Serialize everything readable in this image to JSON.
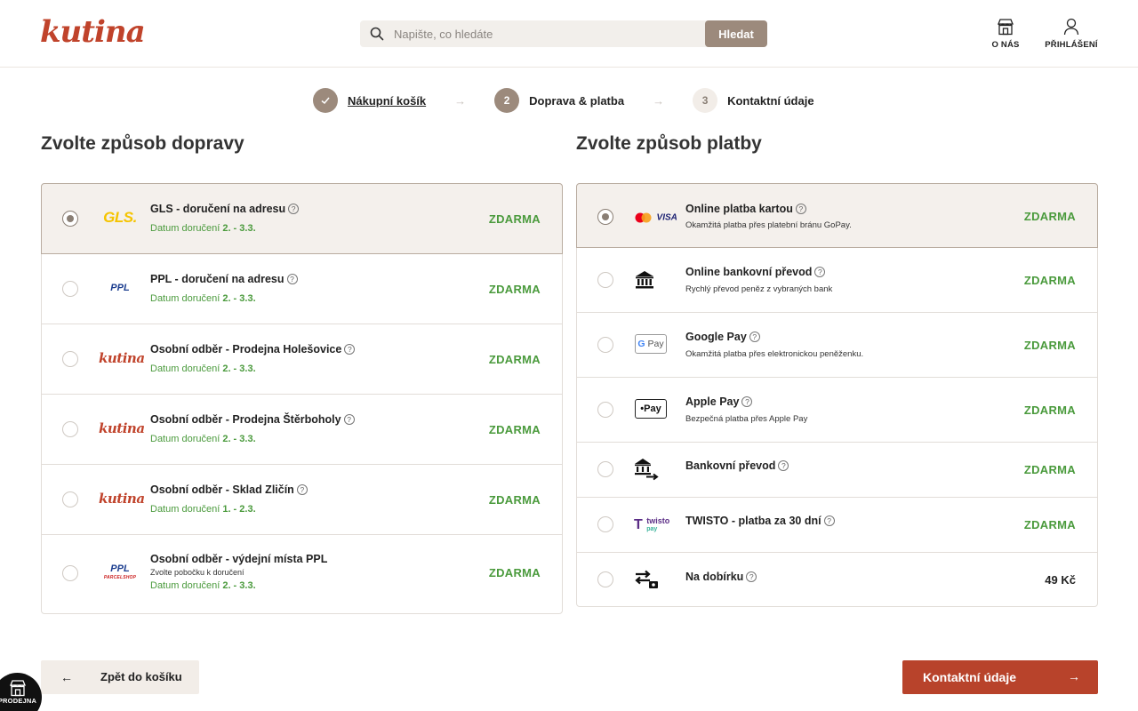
{
  "brand": {
    "logo_text": "kutina"
  },
  "search": {
    "placeholder": "Napište, co hledáte",
    "button_label": "Hledat"
  },
  "header_nav": {
    "about_label": "O NÁS",
    "login_label": "PŘIHLÁŠENÍ"
  },
  "stepper": [
    {
      "number": "",
      "label": "Nákupní košík",
      "state": "done"
    },
    {
      "number": "2",
      "label": "Doprava & platba",
      "state": "active"
    },
    {
      "number": "3",
      "label": "Kontaktní údaje",
      "state": "next"
    }
  ],
  "shipping": {
    "title": "Zvolte způsob dopravy",
    "options": [
      {
        "name": "GLS - doručení na adresu",
        "logo": "gls-logo",
        "date_prefix": "Datum doručení",
        "date": "2. - 3.3.",
        "price": "ZDARMA",
        "selected": true
      },
      {
        "name": "PPL - doručení na adresu",
        "logo": "ppl-logo",
        "date_prefix": "Datum doručení",
        "date": "2. - 3.3.",
        "price": "ZDARMA",
        "selected": false
      },
      {
        "name": "Osobní odběr - Prodejna Holešovice",
        "logo": "kutina-logo",
        "date_prefix": "Datum doručení",
        "date": "2. - 3.3.",
        "price": "ZDARMA",
        "selected": false
      },
      {
        "name": "Osobní odběr - Prodejna Štěrboholy",
        "logo": "kutina-logo",
        "date_prefix": "Datum doručení",
        "date": "2. - 3.3.",
        "price": "ZDARMA",
        "selected": false
      },
      {
        "name": "Osobní odběr - Sklad Zličín",
        "logo": "kutina-logo",
        "date_prefix": "Datum doručení",
        "date": "1. - 2.3.",
        "price": "ZDARMA",
        "selected": false
      },
      {
        "name": "Osobní odběr - výdejní místa PPL",
        "logo": "ppl-parcelshop-logo",
        "subtitle": "Zvolte pobočku k doručení",
        "date_prefix": "Datum doručení",
        "date": "2. - 3.3.",
        "price": "ZDARMA",
        "selected": false
      }
    ]
  },
  "payment": {
    "title": "Zvolte způsob platby",
    "options": [
      {
        "name": "Online platba kartou",
        "logo": "mastercard-visa-logo",
        "subtitle": "Okamžitá platba přes platební bránu GoPay.",
        "price": "ZDARMA",
        "selected": true
      },
      {
        "name": "Online bankovní převod",
        "logo": "bank-icon",
        "subtitle": "Rychlý převod peněz z vybraných bank",
        "price": "ZDARMA",
        "selected": false
      },
      {
        "name": "Google Pay",
        "logo": "google-pay-logo",
        "subtitle": "Okamžitá platba přes elektronickou peněženku.",
        "price": "ZDARMA",
        "selected": false
      },
      {
        "name": "Apple Pay",
        "logo": "apple-pay-logo",
        "subtitle": "Bezpečná platba přes Apple Pay",
        "price": "ZDARMA",
        "selected": false
      },
      {
        "name": "Bankovní převod",
        "logo": "bank-transfer-icon",
        "price": "ZDARMA",
        "selected": false
      },
      {
        "name": "TWISTO - platba za 30 dní",
        "logo": "twisto-logo",
        "price": "ZDARMA",
        "selected": false
      },
      {
        "name": "Na dobírku",
        "logo": "cash-on-delivery-icon",
        "price": "49 Kč",
        "selected": false
      }
    ]
  },
  "logos": {
    "gls": "GLS",
    "ppl": "PPL",
    "ppl_small": "PARCELSHOP",
    "visa": "VISA",
    "gpay": "Pay",
    "apay": "Pay",
    "twisto": "twisto",
    "twisto_sub": "pay"
  },
  "actions": {
    "back_label": "Zpět do košíku",
    "next_label": "Kontaktní údaje"
  },
  "store_badge": {
    "label": "PRODEJNA"
  },
  "colors": {
    "accent": "#b8432b",
    "brand": "#c0432b",
    "taupe": "#9c8a7c",
    "free_green": "#4a9a3c"
  }
}
